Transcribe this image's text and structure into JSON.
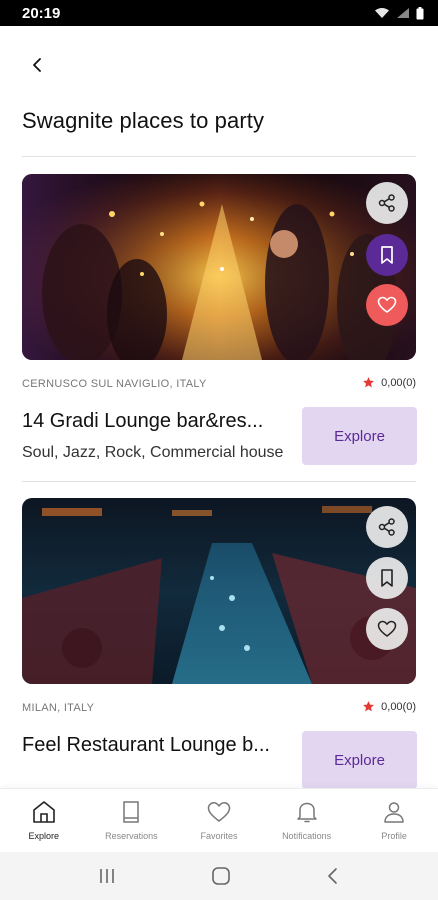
{
  "status_bar": {
    "time": "20:19"
  },
  "header": {
    "title": "Swagnite places to party"
  },
  "cards": [
    {
      "location": "CERNUSCO SUL NAVIGLIO, ITALY",
      "rating": "0,00(0)",
      "name": "14 Gradi Lounge bar&res...",
      "tags": "Soul, Jazz, Rock, Commercial house",
      "explore_label": "Explore",
      "saved": true,
      "favorited": true
    },
    {
      "location": "MILAN, ITALY",
      "rating": "0,00(0)",
      "name": "Feel Restaurant Lounge b...",
      "explore_label": "Explore",
      "saved": false,
      "favorited": false
    }
  ],
  "bottom_nav": {
    "items": [
      {
        "label": "Explore",
        "icon": "home-icon",
        "active": true
      },
      {
        "label": "Reservations",
        "icon": "book-icon",
        "active": false
      },
      {
        "label": "Favorites",
        "icon": "heart-icon",
        "active": false
      },
      {
        "label": "Notifications",
        "icon": "bell-icon",
        "active": false
      },
      {
        "label": "Profile",
        "icon": "person-icon",
        "active": false
      }
    ]
  },
  "colors": {
    "accent": "#5b2a97",
    "explore_bg": "#e3d6f1",
    "favorite": "#ef5a5a",
    "star": "#e53935"
  }
}
